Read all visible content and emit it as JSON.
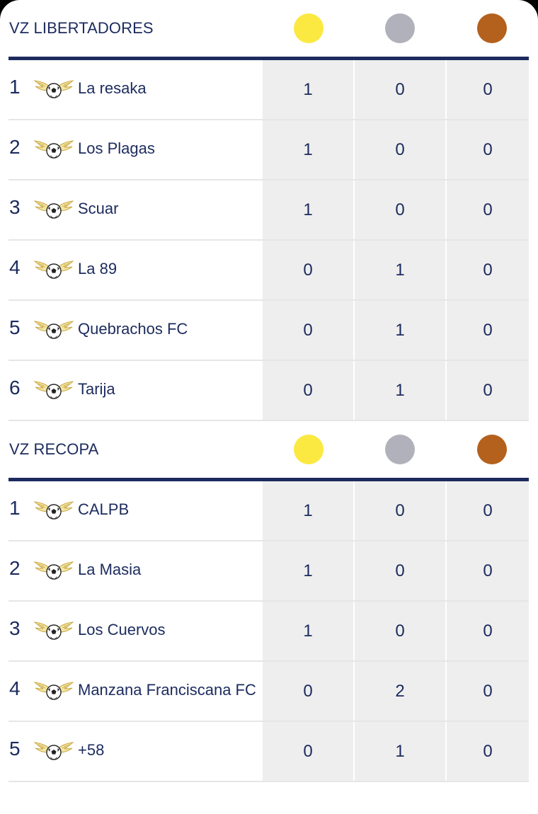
{
  "colors": {
    "navy": "#1c2b5e",
    "gold": "#fbe941",
    "silver": "#b1b1bb",
    "bronze": "#b3611d",
    "cell_bg": "#eeeeee"
  },
  "icons": {
    "team_logo": "winged-soccer-ball-icon",
    "gold": "gold-medal-icon",
    "silver": "silver-medal-icon",
    "bronze": "bronze-medal-icon"
  },
  "sections": [
    {
      "title": "VZ LIBERTADORES",
      "rows": [
        {
          "pos": "1",
          "team": "La resaka",
          "gold": "1",
          "silver": "0",
          "bronze": "0"
        },
        {
          "pos": "2",
          "team": "Los Plagas",
          "gold": "1",
          "silver": "0",
          "bronze": "0"
        },
        {
          "pos": "3",
          "team": "Scuar",
          "gold": "1",
          "silver": "0",
          "bronze": "0"
        },
        {
          "pos": "4",
          "team": "La 89",
          "gold": "0",
          "silver": "1",
          "bronze": "0"
        },
        {
          "pos": "5",
          "team": "Quebrachos FC",
          "gold": "0",
          "silver": "1",
          "bronze": "0"
        },
        {
          "pos": "6",
          "team": "Tarija",
          "gold": "0",
          "silver": "1",
          "bronze": "0"
        }
      ]
    },
    {
      "title": "VZ RECOPA",
      "rows": [
        {
          "pos": "1",
          "team": "CALPB",
          "gold": "1",
          "silver": "0",
          "bronze": "0"
        },
        {
          "pos": "2",
          "team": "La Masia",
          "gold": "1",
          "silver": "0",
          "bronze": "0"
        },
        {
          "pos": "3",
          "team": "Los Cuervos",
          "gold": "1",
          "silver": "0",
          "bronze": "0"
        },
        {
          "pos": "4",
          "team": "Manzana Franciscana FC",
          "gold": "0",
          "silver": "2",
          "bronze": "0"
        },
        {
          "pos": "5",
          "team": "+58",
          "gold": "0",
          "silver": "1",
          "bronze": "0"
        }
      ]
    }
  ]
}
